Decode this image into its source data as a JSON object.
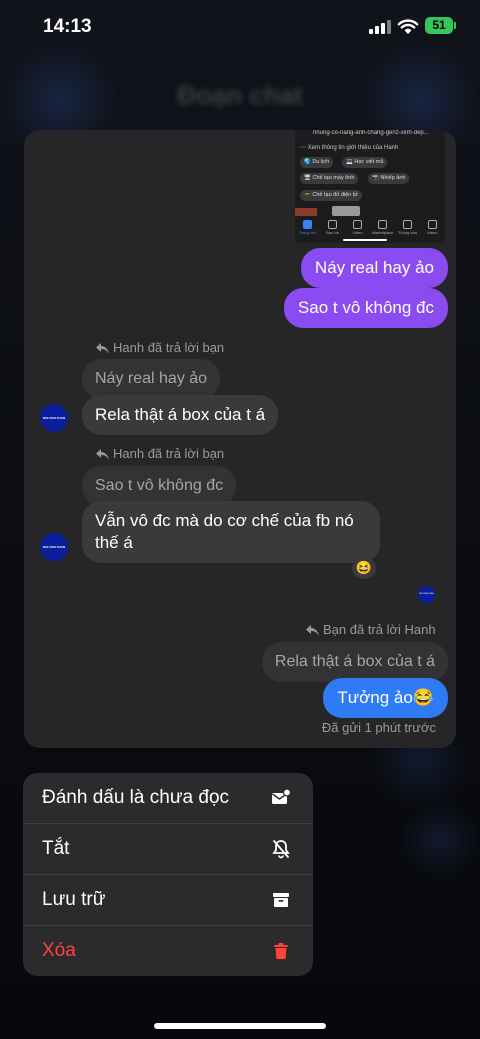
{
  "status_bar": {
    "time": "14:13",
    "battery": "51"
  },
  "background": {
    "title": "Đoạn chat"
  },
  "embedded_screenshot": {
    "url_text": "nhung-co-nang-anh-chang-genz-xinh-dep...",
    "info_text": "Xem thông tin giới thiệu của Hanh",
    "chips": [
      "Du lịch",
      "Học viết mã",
      "Chế tạo máy tính",
      "Nhiếp ảnh",
      "Chế tạo đồ điện tử"
    ],
    "nav": [
      "Trang chủ",
      "Bạn bè",
      "Video",
      "Marketplace",
      "Thông báo",
      "Menu"
    ]
  },
  "conversation": {
    "sent_1": "Náy real hay ảo",
    "sent_2": "Sao t vô không đc",
    "reply_header_1": "Hanh đã trả lời bạn",
    "quoted_1": "Náy real hay ảo",
    "received_1": "Rela thật á box của t á",
    "reply_header_2": "Hanh đã trả lời bạn",
    "quoted_2": "Sao t vô không đc",
    "received_2": "Vẫn vô đc mà do cơ chế của fb nó thế á",
    "reaction": "😆",
    "avatar_text": "NGUYEN XUAN HANH",
    "reply_header_3": "Bạn đã trả lời Hanh",
    "quoted_3": "Rela thật á box của t á",
    "sent_3": "Tưởng ảo😂",
    "sent_status": "Đã gửi 1 phút trước"
  },
  "menu": {
    "items": [
      {
        "label": "Đánh dấu là chưa đọc",
        "icon": "mark-unread-icon"
      },
      {
        "label": "Tắt",
        "icon": "bell-slash-icon"
      },
      {
        "label": "Lưu trữ",
        "icon": "archive-icon"
      },
      {
        "label": "Xóa",
        "icon": "trash-icon"
      }
    ]
  },
  "colors": {
    "sent_bubble": "#8a4cf0",
    "blue_bubble": "#2f7bf5",
    "danger": "#ff453a",
    "battery": "#34c759"
  }
}
